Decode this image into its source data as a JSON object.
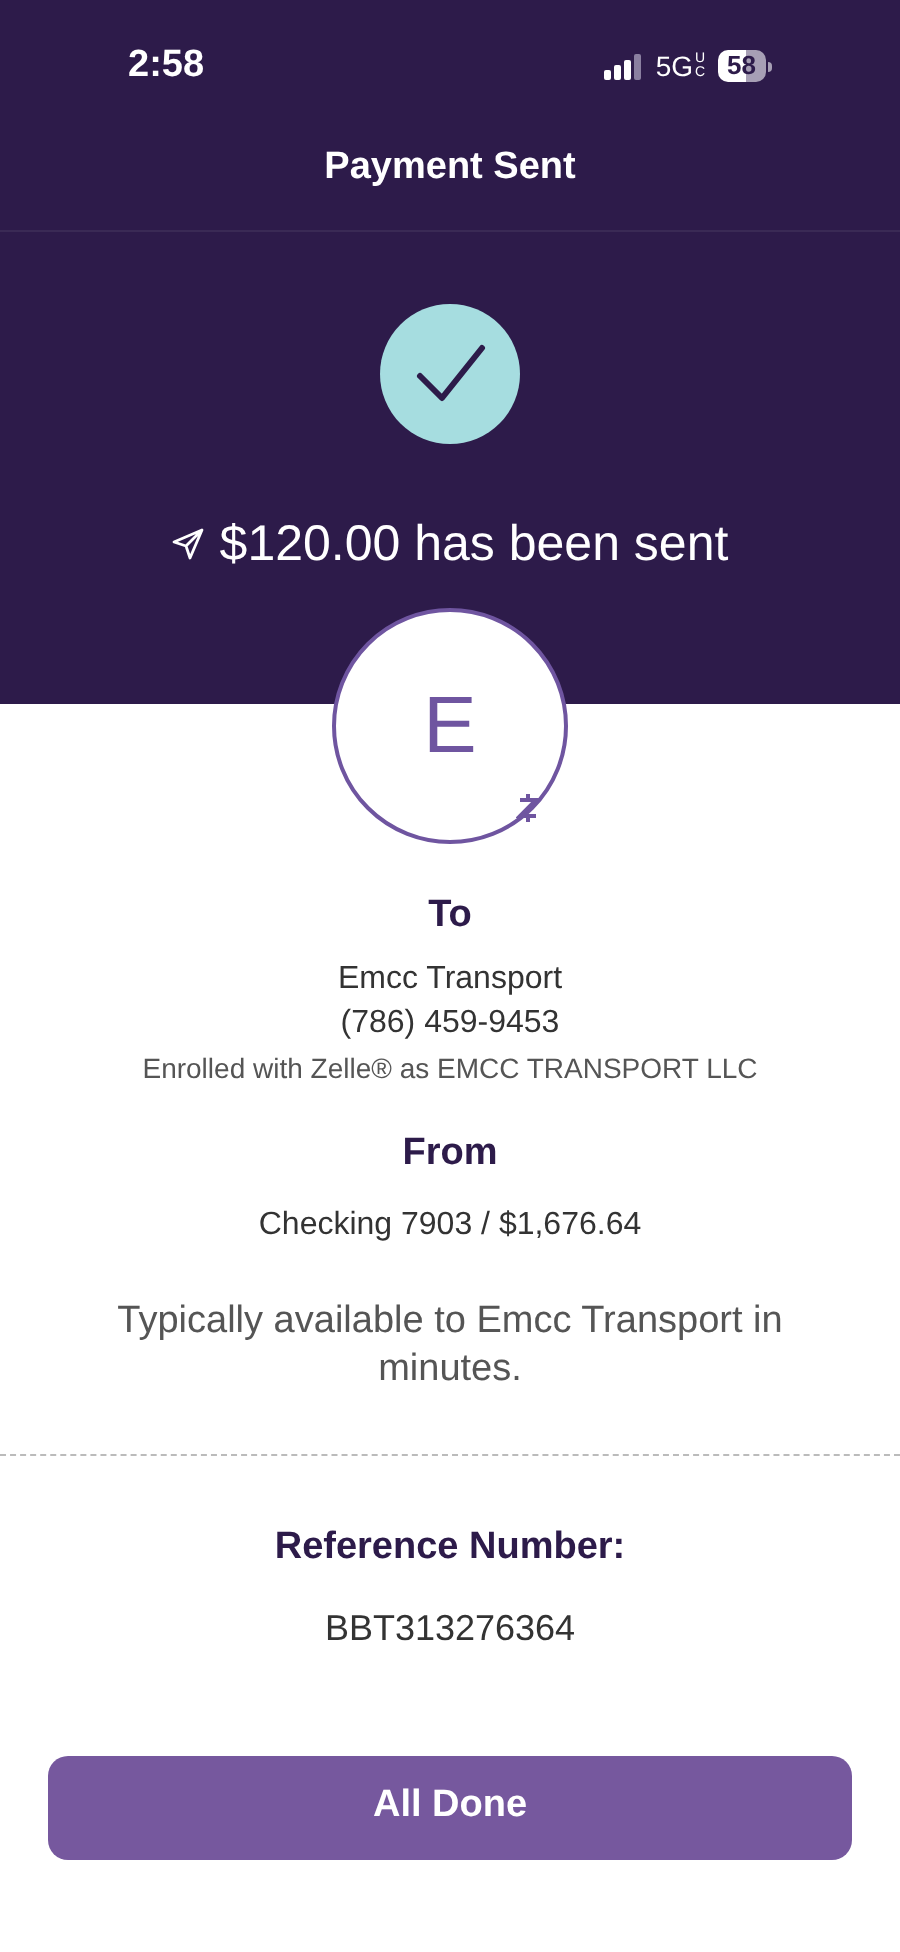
{
  "status_bar": {
    "time": "2:58",
    "network": "5G",
    "network_suffix": "UC",
    "battery": "58"
  },
  "title": "Payment Sent",
  "amount_message": "$120.00 has been sent",
  "avatar_initial": "E",
  "to": {
    "heading": "To",
    "name": "Emcc Transport",
    "phone": "(786) 459-9453",
    "enrolled": "Enrolled with Zelle® as EMCC TRANSPORT LLC"
  },
  "from": {
    "heading": "From",
    "account": "Checking 7903 / $1,676.64"
  },
  "availability": "Typically available to Emcc Transport in minutes.",
  "reference": {
    "label": "Reference Number:",
    "value": "BBT313276364"
  },
  "button": "All Done"
}
